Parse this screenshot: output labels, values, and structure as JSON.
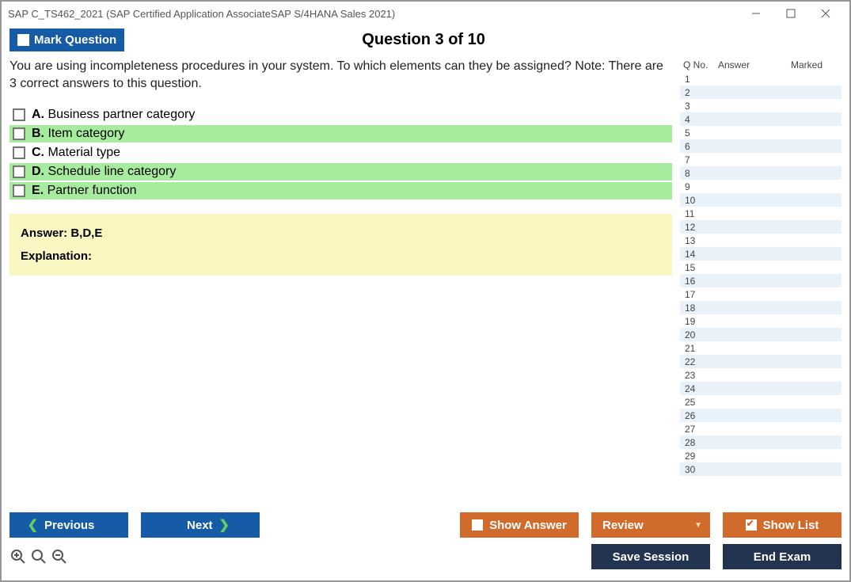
{
  "window": {
    "title": "SAP C_TS462_2021 (SAP Certified Application AssociateSAP S/4HANA Sales 2021)"
  },
  "header": {
    "mark_label": "Mark Question",
    "question_title": "Question 3 of 10"
  },
  "question": {
    "text": "You are using incompleteness procedures in your system. To which elements can they be assigned? Note: There are 3 correct answers to this question.",
    "options": [
      {
        "letter": "A.",
        "text": "Business partner category",
        "correct": false
      },
      {
        "letter": "B.",
        "text": "Item category",
        "correct": true
      },
      {
        "letter": "C.",
        "text": "Material type",
        "correct": false
      },
      {
        "letter": "D.",
        "text": "Schedule line category",
        "correct": true
      },
      {
        "letter": "E.",
        "text": "Partner function",
        "correct": true
      }
    ],
    "answer_line": "Answer: B,D,E",
    "explanation_label": "Explanation:"
  },
  "nav": {
    "headers": {
      "qno": "Q No.",
      "answer": "Answer",
      "marked": "Marked"
    },
    "rows": 30
  },
  "footer": {
    "previous": "Previous",
    "next": "Next",
    "show_answer": "Show Answer",
    "review": "Review",
    "show_list": "Show List",
    "save_session": "Save Session",
    "end_exam": "End Exam"
  }
}
